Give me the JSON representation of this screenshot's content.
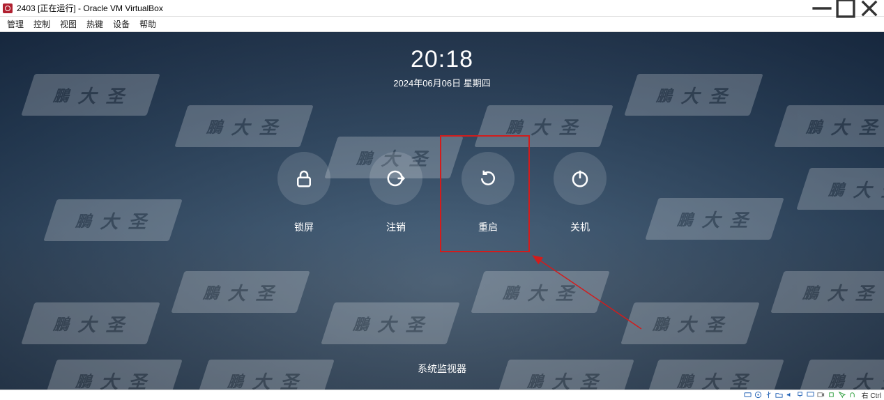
{
  "host": {
    "title": "2403 [正在运行] - Oracle VM VirtualBox",
    "menu": {
      "manage": "管理",
      "control": "控制",
      "view": "视图",
      "hotkeys": "热键",
      "devices": "设备",
      "help": "帮助"
    },
    "status_host_key": "右 Ctrl"
  },
  "guest": {
    "time": "20:18",
    "date": "2024年06月06日 星期四",
    "actions": {
      "lock": "锁屏",
      "logout": "注销",
      "reboot": "重启",
      "shutdown": "关机"
    },
    "bottom_link": "系统监视器",
    "watermark_chars": {
      "a": "鵬",
      "b": "大",
      "c": "圣"
    }
  }
}
